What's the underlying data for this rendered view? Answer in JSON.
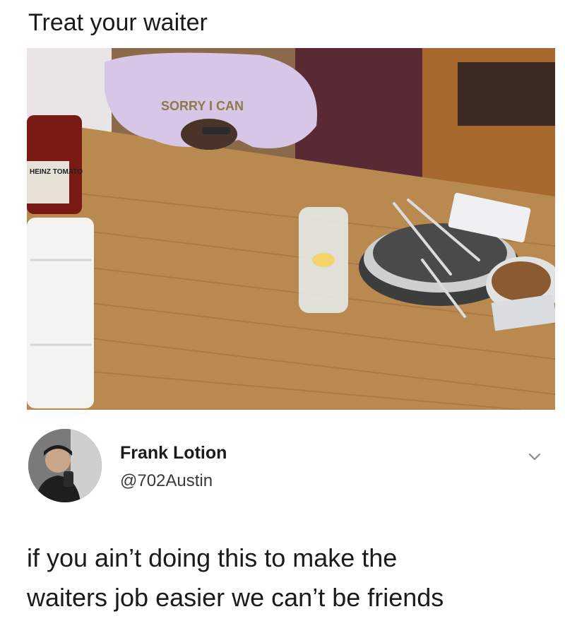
{
  "meme": {
    "caption": "Treat your waiter"
  },
  "photo": {
    "shirt_text": "SORRY I CAN",
    "ketchup_label": "HEINZ TOMATO"
  },
  "tweet": {
    "display_name": "Frank Lotion",
    "handle": "@702Austin",
    "text_lines": [
      "if you ain’t doing this to make the",
      "waiters job easier we can’t be friends"
    ]
  },
  "icons": {
    "more": "chevron-down-icon"
  },
  "colors": {
    "table_wood": "#b98a4f",
    "booth_red": "#5a2a34",
    "hoodie": "#d8c6e6",
    "text": "#1b1b1b",
    "handle_gray": "#3a3a3a"
  }
}
